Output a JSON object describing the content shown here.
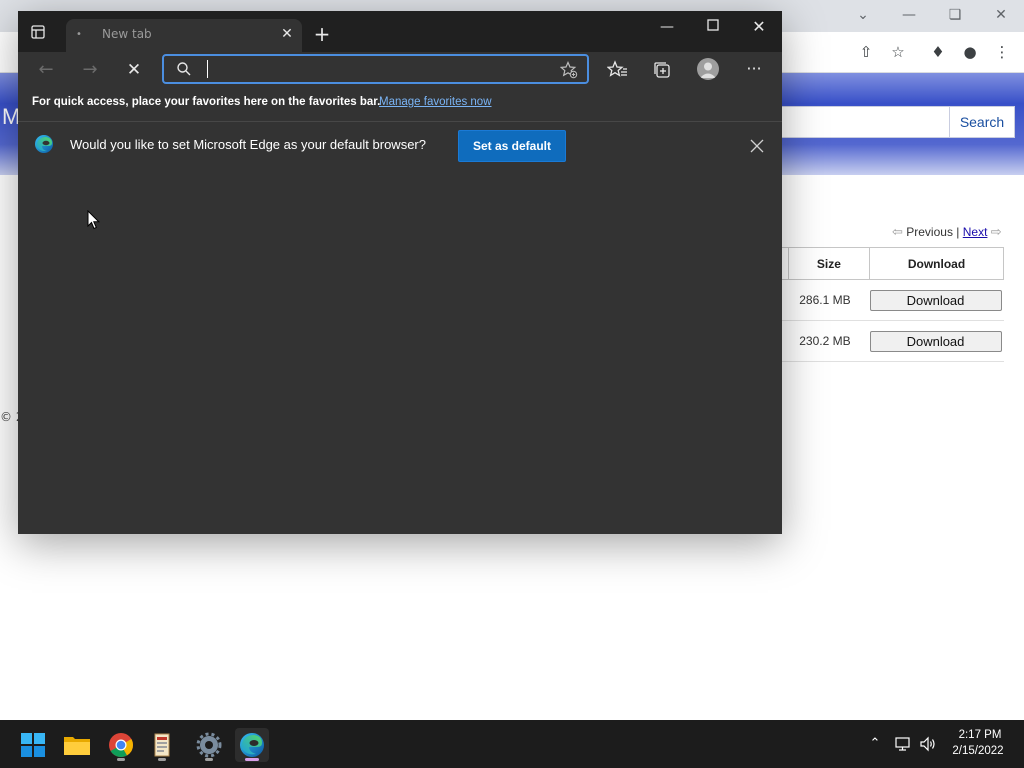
{
  "edge": {
    "tab_title": "New tab",
    "address_placeholder": "",
    "favorites_bar_text": "For quick access, place your favorites here on the favorites bar.",
    "favorites_bar_link": "Manage favorites now",
    "banner_text": "Would you like to set Microsoft Edge as your default browser?",
    "set_default_label": "Set as default",
    "accent_color": "#0f6cbd",
    "address_focus_color": "#4b8ee0",
    "icons": [
      "tab-actions-icon",
      "close-icon",
      "plus-icon",
      "minimize-icon",
      "maximize-icon",
      "back-arrow-icon",
      "forward-arrow-icon",
      "stop-icon",
      "search-icon",
      "add-favorite-icon",
      "favorites-icon",
      "collections-icon",
      "profile-icon",
      "more-icon",
      "edge-logo-icon"
    ]
  },
  "background_page": {
    "search_button": "Search",
    "pager_prev": "Previous",
    "pager_sep": "|",
    "pager_next": "Next",
    "table_headers": [
      "Size",
      "Download"
    ],
    "rows": [
      {
        "size": "286.1 MB",
        "download": "Download"
      },
      {
        "size": "230.2 MB",
        "download": "Download"
      }
    ],
    "copyright_fragment": "© 2",
    "left_letter": "M"
  },
  "taskbar": {
    "apps": [
      "start-icon",
      "file-explorer-icon",
      "chrome-icon",
      "notepad-app-icon",
      "settings-icon",
      "edge-icon"
    ],
    "clock_time": "2:17 PM",
    "clock_date": "2/15/2022"
  }
}
